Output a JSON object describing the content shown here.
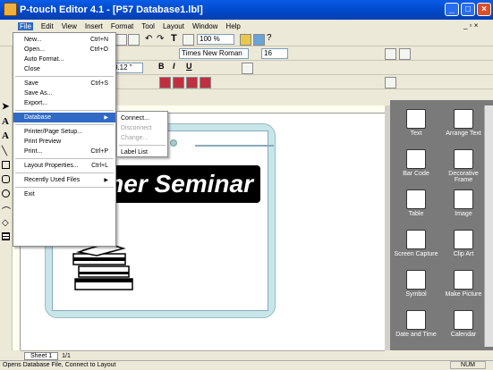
{
  "window": {
    "title": "P-touch Editor 4.1 - [P57 Database1.lbl]"
  },
  "menubar": {
    "items": [
      "File",
      "Edit",
      "View",
      "Insert",
      "Format",
      "Tool",
      "Layout",
      "Window",
      "Help"
    ]
  },
  "toolbar": {
    "zoom": "100 %",
    "font": "Times New Roman",
    "size": "16",
    "width": "0.12 \""
  },
  "file_menu": {
    "items": [
      {
        "label": "New...",
        "shortcut": "Ctrl+N"
      },
      {
        "label": "Open...",
        "shortcut": "Ctrl+O"
      },
      {
        "label": "Auto Format...",
        "shortcut": ""
      },
      {
        "label": "Close",
        "shortcut": ""
      },
      {
        "label": "Save",
        "shortcut": "Ctrl+S"
      },
      {
        "label": "Save As...",
        "shortcut": ""
      },
      {
        "label": "Export...",
        "shortcut": ""
      },
      {
        "label": "Database",
        "shortcut": ""
      },
      {
        "label": "Printer/Page Setup...",
        "shortcut": ""
      },
      {
        "label": "Print Preview",
        "shortcut": ""
      },
      {
        "label": "Print...",
        "shortcut": "Ctrl+P"
      },
      {
        "label": "Layout Properties...",
        "shortcut": "Ctrl+L"
      },
      {
        "label": "Recently Used Files",
        "shortcut": ""
      },
      {
        "label": "Exit",
        "shortcut": ""
      }
    ]
  },
  "database_submenu": {
    "items": [
      "Connect...",
      "Disconnect",
      "Change...",
      "Label List"
    ]
  },
  "canvas": {
    "title_text": "mer Seminar"
  },
  "panel": {
    "items": [
      "Text",
      "Arrange Text",
      "Bar Code",
      "Decorative Frame",
      "Table",
      "Image",
      "Screen Capture",
      "Clip Art",
      "Symbol",
      "Make Picture",
      "Date and Time",
      "Calendar"
    ]
  },
  "sheets": {
    "tab": "Sheet 1",
    "page": "1/1"
  },
  "status": {
    "text": "Opens Database File, Connect to Layout",
    "num": "NUM"
  }
}
